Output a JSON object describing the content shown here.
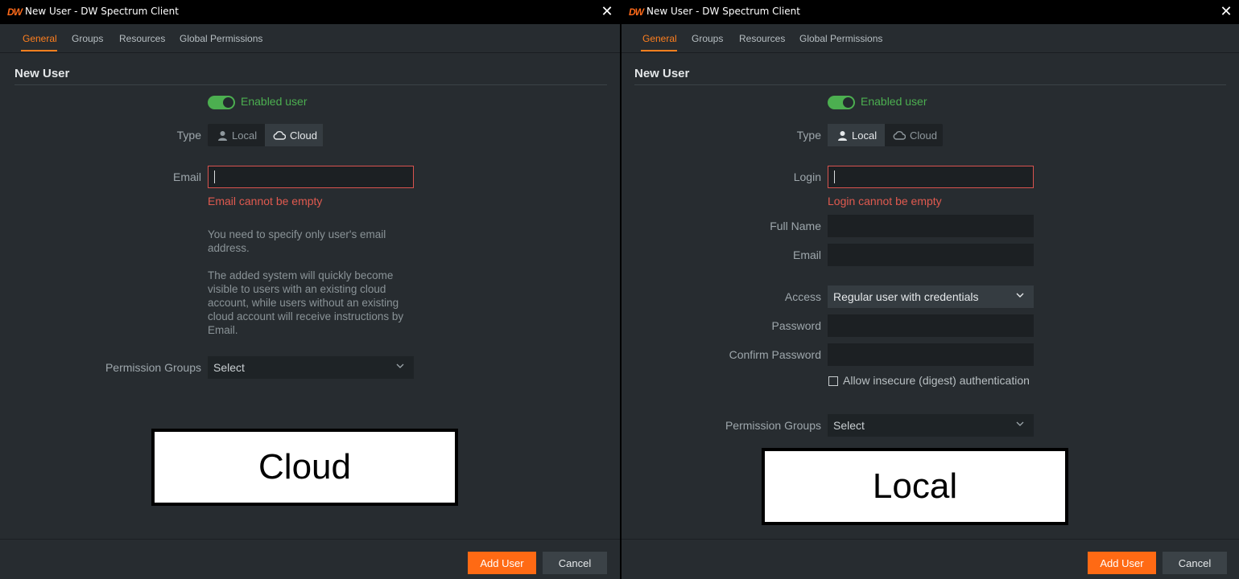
{
  "left": {
    "window_title": "New User - DW Spectrum Client",
    "logo": "DW",
    "tabs": [
      "General",
      "Groups",
      "Resources",
      "Global Permissions"
    ],
    "section_title": "New User",
    "enabled_label": "Enabled user",
    "type_label": "Type",
    "type_options": [
      "Local",
      "Cloud"
    ],
    "selected_type": "Cloud",
    "email_label": "Email",
    "email_value": "",
    "email_error": "Email cannot be empty",
    "hint_1": "You need to specify only user's email address.",
    "hint_2": "The added system will quickly become visible to users with an existing cloud account, while users without an existing cloud account will receive instructions by Email.",
    "permission_groups_label": "Permission Groups",
    "permission_groups_value": "Select",
    "overlay_text": "Cloud",
    "add_button": "Add User",
    "cancel_button": "Cancel"
  },
  "right": {
    "window_title": "New User - DW Spectrum Client",
    "logo": "DW",
    "tabs": [
      "General",
      "Groups",
      "Resources",
      "Global Permissions"
    ],
    "section_title": "New User",
    "enabled_label": "Enabled user",
    "type_label": "Type",
    "type_options": [
      "Local",
      "Cloud"
    ],
    "selected_type": "Local",
    "login_label": "Login",
    "login_value": "",
    "login_error": "Login cannot be empty",
    "full_name_label": "Full Name",
    "email_label": "Email",
    "access_label": "Access",
    "access_value": "Regular user with credentials",
    "password_label": "Password",
    "confirm_password_label": "Confirm Password",
    "insecure_auth_label": "Allow insecure (digest) authentication",
    "permission_groups_label": "Permission Groups",
    "permission_groups_value": "Select",
    "overlay_text": "Local",
    "add_button": "Add User",
    "cancel_button": "Cancel"
  },
  "colors": {
    "accent": "#ff7f1e",
    "enabled_green": "#4caf50",
    "error_red": "#e05a4f",
    "window_bg": "#272c30"
  }
}
